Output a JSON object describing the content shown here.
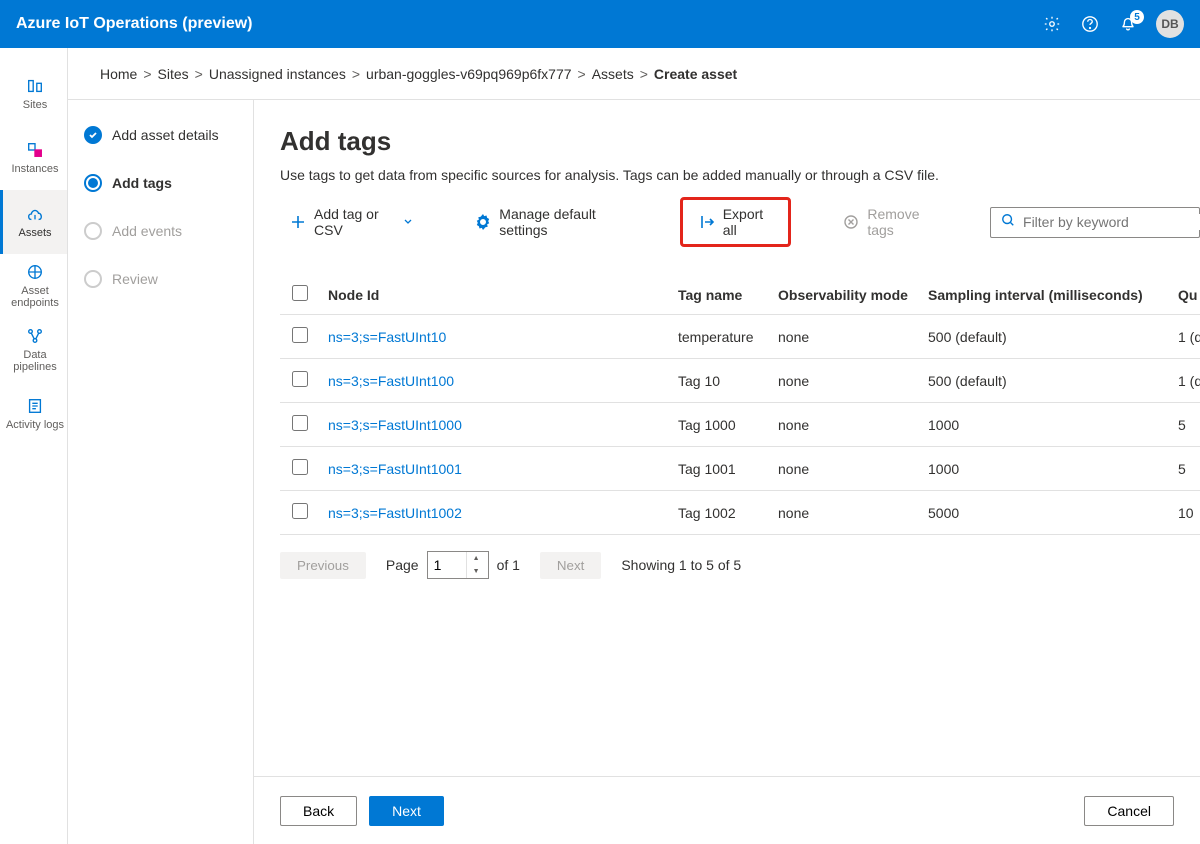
{
  "header": {
    "title": "Azure IoT Operations (preview)",
    "notif_count": "5",
    "avatar_initials": "DB"
  },
  "rail": {
    "items": [
      {
        "label": "Sites",
        "icon": "sites"
      },
      {
        "label": "Instances",
        "icon": "instances"
      },
      {
        "label": "Assets",
        "icon": "assets",
        "active": true
      },
      {
        "label": "Asset endpoints",
        "icon": "endpoints"
      },
      {
        "label": "Data pipelines",
        "icon": "pipelines"
      },
      {
        "label": "Activity logs",
        "icon": "logs"
      }
    ]
  },
  "breadcrumb": {
    "items": [
      "Home",
      "Sites",
      "Unassigned instances",
      "urban-goggles-v69pq969p6fx777",
      "Assets"
    ],
    "current": "Create asset"
  },
  "steps": {
    "items": [
      {
        "label": "Add asset details",
        "state": "completed"
      },
      {
        "label": "Add tags",
        "state": "active"
      },
      {
        "label": "Add events",
        "state": "disabled"
      },
      {
        "label": "Review",
        "state": "disabled"
      }
    ]
  },
  "page": {
    "title": "Add tags",
    "description": "Use tags to get data from specific sources for analysis. Tags can be added manually or through a CSV file."
  },
  "toolbar": {
    "add_label": "Add tag or CSV",
    "manage_label": "Manage default settings",
    "export_label": "Export all",
    "remove_label": "Remove tags",
    "filter_placeholder": "Filter by keyword"
  },
  "table": {
    "columns": [
      "Node Id",
      "Tag name",
      "Observability mode",
      "Sampling interval (milliseconds)",
      "Qu"
    ],
    "rows": [
      {
        "node": "ns=3;s=FastUInt10",
        "tag": "temperature",
        "obs": "none",
        "samp": "500 (default)",
        "qu": "1 (d"
      },
      {
        "node": "ns=3;s=FastUInt100",
        "tag": "Tag 10",
        "obs": "none",
        "samp": "500 (default)",
        "qu": "1 (d"
      },
      {
        "node": "ns=3;s=FastUInt1000",
        "tag": "Tag 1000",
        "obs": "none",
        "samp": "1000",
        "qu": "5"
      },
      {
        "node": "ns=3;s=FastUInt1001",
        "tag": "Tag 1001",
        "obs": "none",
        "samp": "1000",
        "qu": "5"
      },
      {
        "node": "ns=3;s=FastUInt1002",
        "tag": "Tag 1002",
        "obs": "none",
        "samp": "5000",
        "qu": "10"
      }
    ]
  },
  "pager": {
    "prev": "Previous",
    "page_label": "Page",
    "page_value": "1",
    "of_label": "of 1",
    "next": "Next",
    "showing": "Showing 1 to 5 of 5"
  },
  "footer": {
    "back": "Back",
    "next": "Next",
    "cancel": "Cancel"
  }
}
